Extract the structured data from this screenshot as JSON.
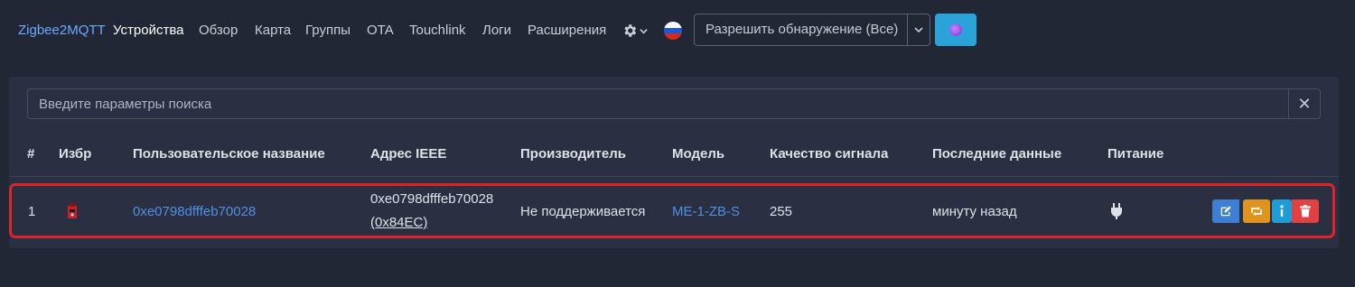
{
  "nav": {
    "brand": "Zigbee2MQTT",
    "items": [
      "Устройства",
      "Обзор",
      "Карта",
      "Группы",
      "OTA",
      "Touchlink",
      "Логи",
      "Расширения"
    ],
    "active": "Устройства",
    "permit_join_label": "Разрешить обнаружение (Все)",
    "icons": [
      "gear-icon",
      "chevron-down-icon",
      "flag-ru-icon",
      "status-dot-icon"
    ]
  },
  "search": {
    "placeholder": "Введите параметры поиска",
    "value": ""
  },
  "table": {
    "headers": [
      "#",
      "Избр",
      "Пользовательское название",
      "Адрес IEEE",
      "Производитель",
      "Модель",
      "Качество сигнала",
      "Последние данные",
      "Питание"
    ],
    "rows": [
      {
        "index": "1",
        "friendly_name": "0xe0798dfffeb70028",
        "ieee": "0xe0798dfffeb70028",
        "nwk": "(0x84EC)",
        "manufacturer": "Не поддерживается",
        "model": "ME-1-ZB-S",
        "lqi": "255",
        "last_seen": "минуту назад",
        "power_icon": "plug-icon",
        "actions": [
          "edit-icon",
          "reconfigure-icon",
          "info-icon",
          "delete-icon"
        ]
      }
    ]
  },
  "colors": {
    "background": "#222736",
    "card": "#2a3042",
    "link": "#4f8fe6",
    "highlight": "#e0232b",
    "edit": "#3e7fd6",
    "reconfigure": "#e0931d",
    "info": "#1f9cd6",
    "delete": "#e34141"
  }
}
